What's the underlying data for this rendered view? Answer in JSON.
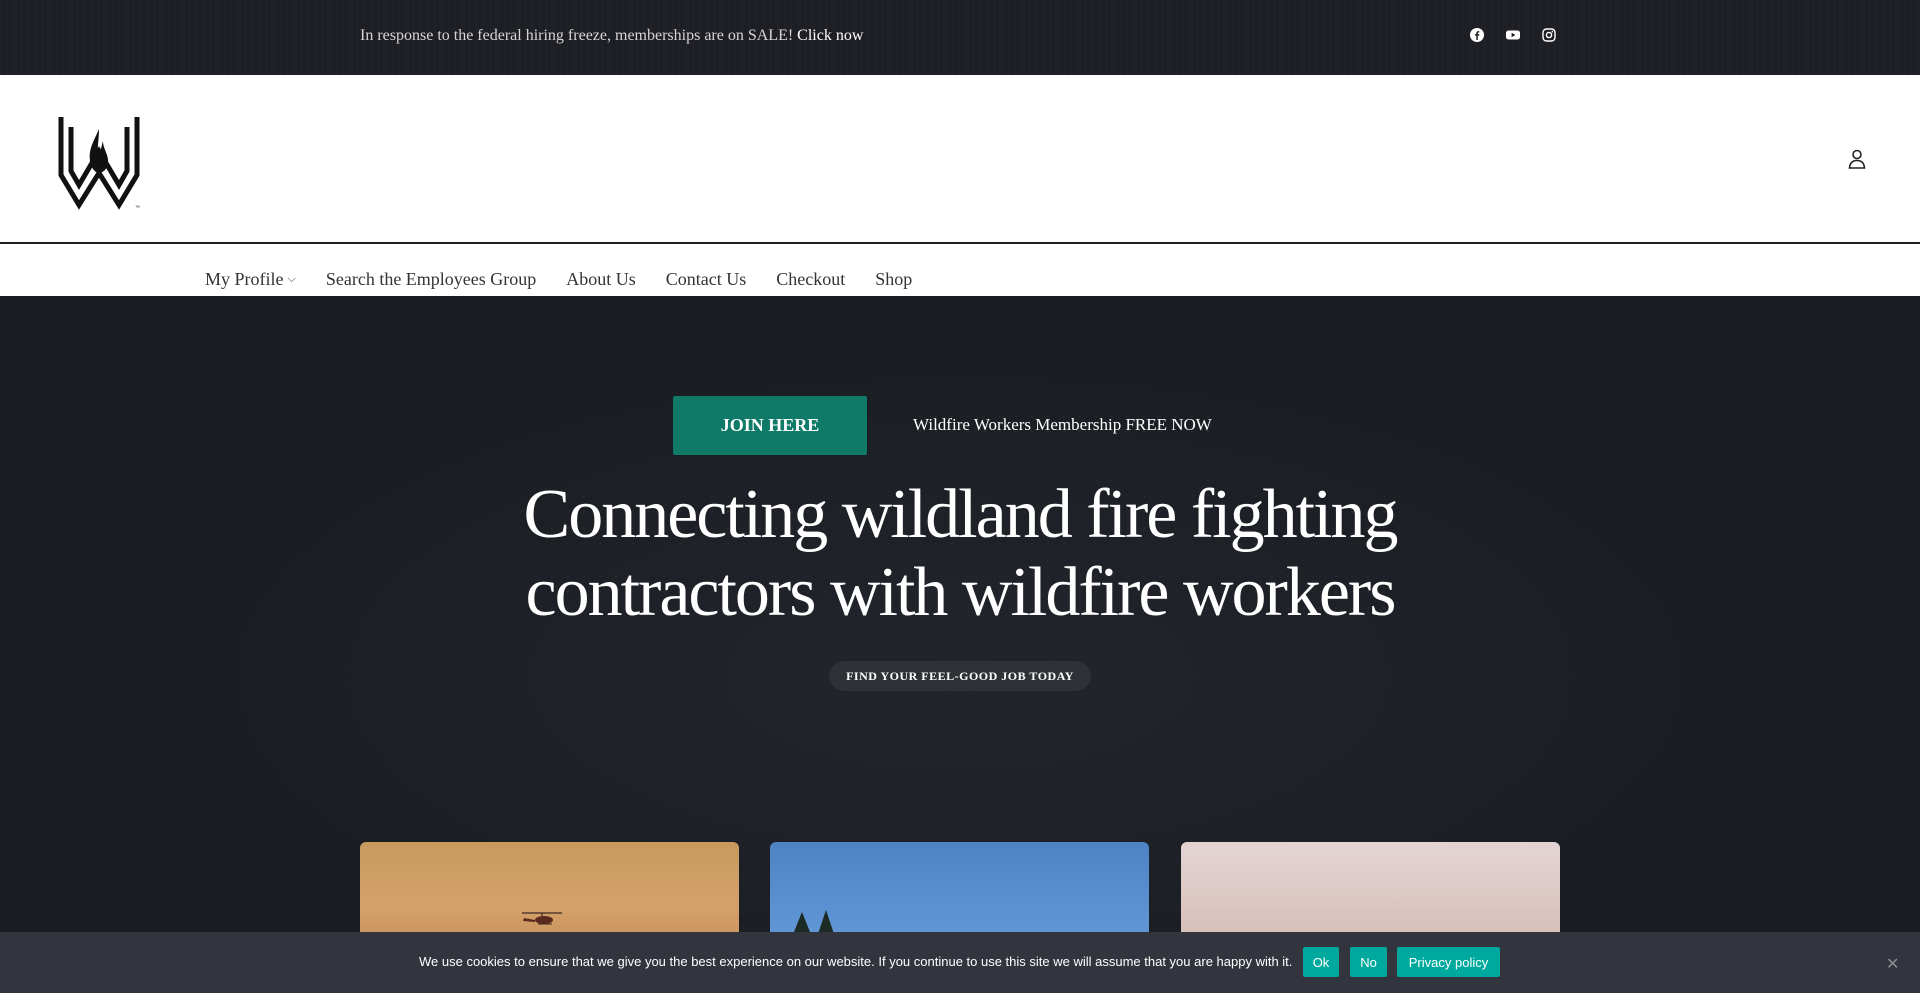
{
  "topbar": {
    "message": "In response to the federal hiring freeze, memberships are on SALE!",
    "link_label": "Click now",
    "socials": [
      "facebook-icon",
      "youtube-icon",
      "instagram-icon"
    ]
  },
  "header": {
    "logo_name": "wildfire-workers-logo",
    "account_icon": "user-account-icon"
  },
  "nav": {
    "items": [
      {
        "label": "My Profile",
        "has_dropdown": true
      },
      {
        "label": "Search the Employees Group"
      },
      {
        "label": "About Us"
      },
      {
        "label": "Contact Us"
      },
      {
        "label": "Checkout"
      },
      {
        "label": "Shop"
      }
    ]
  },
  "hero": {
    "join_label": "JOIN HERE",
    "promo_icon": "",
    "promo_text": "Wildfire Workers Membership FREE NOW",
    "headline_line1": "Connecting wildland fire fighting",
    "headline_line2": "contractors with wildfire workers",
    "pill_label": "FIND YOUR FEEL-GOOD JOB TODAY"
  },
  "cookie": {
    "text": "We use cookies to ensure that we give you the best experience on our website. If you continue to use this site we will assume that you are happy with it.",
    "ok_label": "Ok",
    "no_label": "No",
    "privacy_label": "Privacy policy",
    "close_label": "✕"
  },
  "colors": {
    "accent": "#0f7a68",
    "cookie_button": "#00a99d",
    "dark_bg": "#1a1d22"
  }
}
